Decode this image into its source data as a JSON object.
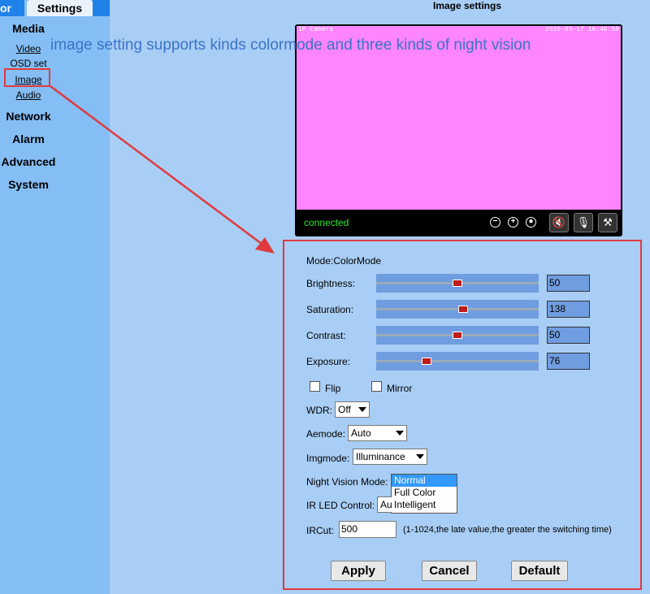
{
  "tabs": {
    "left": "or",
    "settings": "Settings"
  },
  "sidebar": {
    "media": "Media",
    "video": "Video",
    "osd": "OSD set",
    "image": "Image",
    "audio": "Audio",
    "network": "Network",
    "alarm": "Alarm",
    "advanced": "Advanced",
    "system": "System"
  },
  "annotation": "image setting supports kinds colormode and three kinds of night vision",
  "page_title": "Image settings",
  "video": {
    "camera_label": "IP Camera",
    "timestamp": "2020-03-17 16:46:50",
    "status": "connected"
  },
  "settings": {
    "mode_label": "Mode:ColorMode",
    "brightness_label": "Brightness:",
    "brightness_value": "50",
    "saturation_label": "Saturation:",
    "saturation_value": "138",
    "contrast_label": "Contrast:",
    "contrast_value": "50",
    "exposure_label": "Exposure:",
    "exposure_value": "76",
    "flip_label": "Flip",
    "mirror_label": "Mirror",
    "wdr_label": "WDR:",
    "wdr_value": "Off",
    "aemode_label": "Aemode:",
    "aemode_value": "Auto",
    "imgmode_label": "Imgmode:",
    "imgmode_value": "Illuminance",
    "night_vision_label": "Night Vision Mode:",
    "night_vision_options": [
      "Normal",
      "Full Color",
      "Intelligent"
    ],
    "ir_led_label": "IR LED Control:",
    "ir_led_value": "Au",
    "ircut_label": "IRCut:",
    "ircut_value": "500",
    "ircut_hint": "(1-1024,the late value,the greater the switching time)",
    "apply": "Apply",
    "cancel": "Cancel",
    "default": "Default"
  },
  "colors": {
    "highlight": "#e0393e",
    "sidebar": "#85bdf5",
    "background": "#a9cef5",
    "video_pink": "#ff84ff"
  }
}
